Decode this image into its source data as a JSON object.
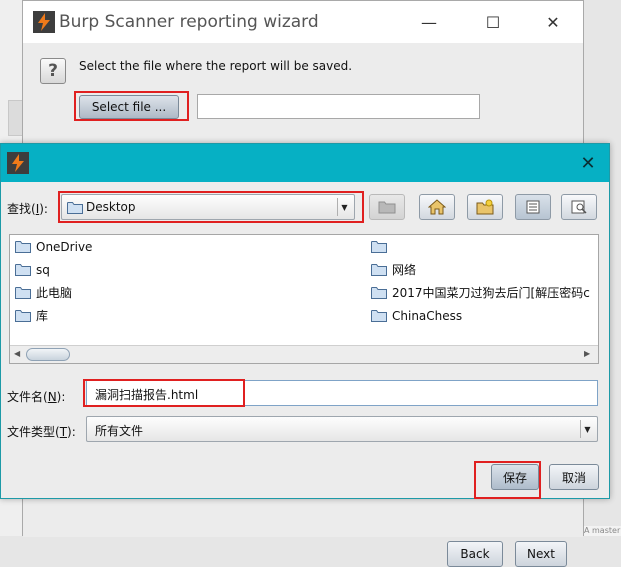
{
  "wizard": {
    "title": "Burp Scanner reporting wizard",
    "prompt": "Select the file where the report will be saved.",
    "select_file_label": "Select file ...",
    "path_value": "",
    "back_label": "Back",
    "next_label": "Next",
    "help_glyph": "?",
    "window_buttons": {
      "minimize": "—",
      "maximize": "☐",
      "close": "✕"
    }
  },
  "edge_text": "A master",
  "dialog": {
    "close_glyph": "✕",
    "look_in": {
      "label": "查找(",
      "mnemonic": "I",
      "label_suffix": "):",
      "value": "Desktop"
    },
    "toolbar": [
      {
        "name": "up-folder-button",
        "icon": "up-folder-icon",
        "enabled": false
      },
      {
        "name": "home-button",
        "icon": "home-icon",
        "enabled": true
      },
      {
        "name": "new-folder-button",
        "icon": "new-folder-icon",
        "enabled": true
      },
      {
        "name": "list-view-button",
        "icon": "list-view-icon",
        "enabled": true,
        "active": true
      },
      {
        "name": "details-view-button",
        "icon": "details-view-icon",
        "enabled": true
      }
    ],
    "files_left": [
      "OneDrive",
      "sq",
      "此电脑",
      "库"
    ],
    "files_right": [
      "",
      "网络",
      "2017中国菜刀过狗去后门[解压密码c",
      "ChinaChess"
    ],
    "file_name": {
      "label": "文件名(",
      "mnemonic": "N",
      "label_suffix": "):",
      "value": "漏洞扫描报告.html"
    },
    "file_type": {
      "label": "文件类型(",
      "mnemonic": "T",
      "label_suffix": "):",
      "value": "所有文件"
    },
    "save_label": "保存",
    "cancel_label": "取消"
  },
  "colors": {
    "dialog_title": "#06b0c4",
    "highlight": "#e02020",
    "burp_orange": "#f07a1a"
  }
}
